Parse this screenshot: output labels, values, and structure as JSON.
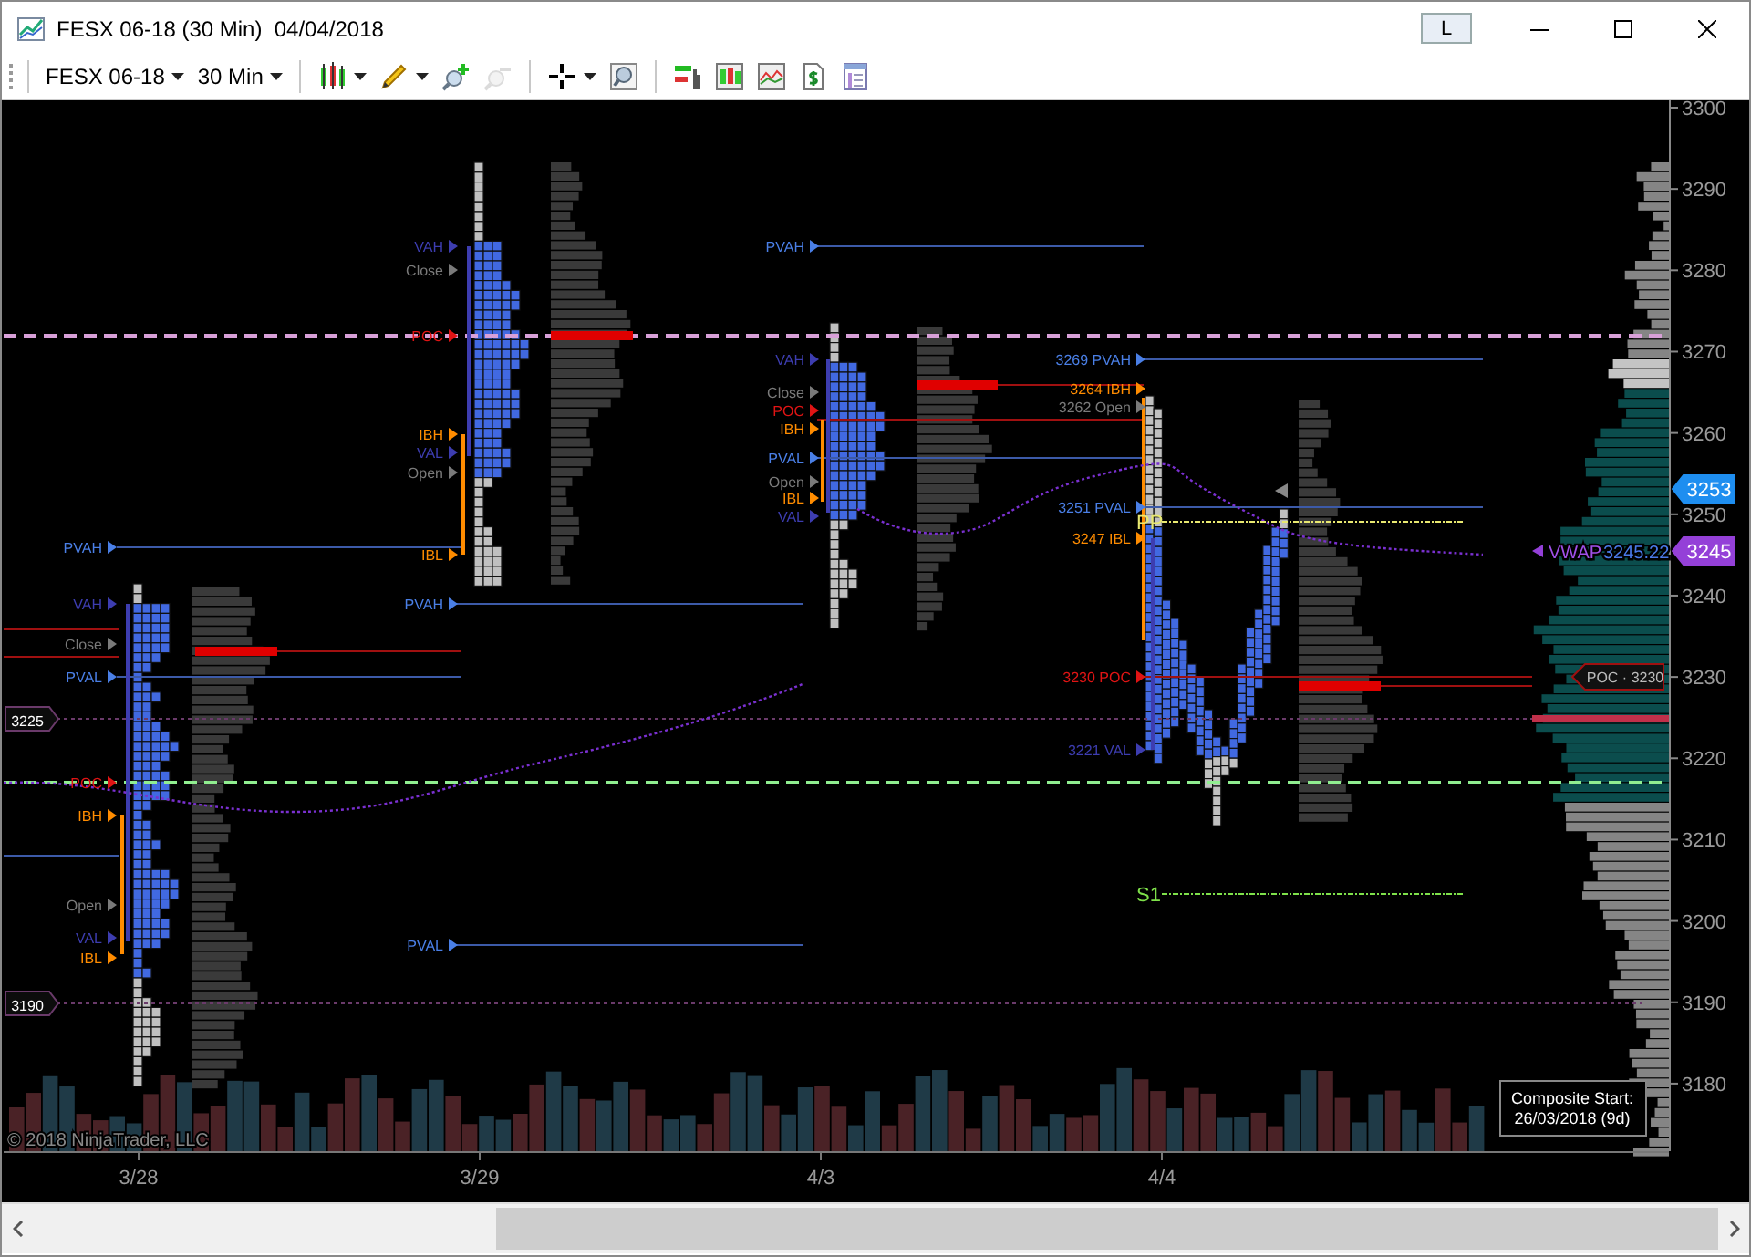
{
  "window": {
    "title": "FESX 06-18 (30 Min)  04/04/2018",
    "badge": "L"
  },
  "toolbar": {
    "instrument": "FESX 06-18",
    "interval": "30 Min",
    "tools": [
      {
        "kind": "chart-style",
        "disabled": false
      },
      {
        "kind": "drawing-tools",
        "disabled": false
      },
      {
        "kind": "zoom-in",
        "disabled": false
      },
      {
        "kind": "zoom-out",
        "disabled": true
      },
      {
        "kind": "crosshair",
        "disabled": false
      },
      {
        "kind": "zoom-box",
        "disabled": false
      },
      {
        "kind": "data-series",
        "disabled": false
      },
      {
        "kind": "bars",
        "disabled": false
      },
      {
        "kind": "indicators",
        "disabled": false
      },
      {
        "kind": "orders",
        "disabled": false
      },
      {
        "kind": "properties",
        "disabled": false
      }
    ]
  },
  "chart": {
    "level_labels": [
      {
        "text": "PVAH",
        "kind": "prior-value"
      },
      {
        "text": "VAH",
        "kind": "value-area"
      },
      {
        "text": "Close",
        "kind": "open-close"
      },
      {
        "text": "PVAL",
        "kind": "prior-value"
      },
      {
        "text": "POC",
        "kind": "poc"
      },
      {
        "text": "IBH",
        "kind": "initial-balance"
      },
      {
        "text": "Open",
        "kind": "open-close"
      },
      {
        "text": "VAL",
        "kind": "value-area"
      },
      {
        "text": "IBL",
        "kind": "initial-balance"
      },
      {
        "text": "VAH",
        "kind": "value-area"
      },
      {
        "text": "Close",
        "kind": "open-close"
      },
      {
        "text": "POC",
        "kind": "poc"
      },
      {
        "text": "IBH",
        "kind": "initial-balance"
      },
      {
        "text": "VAL",
        "kind": "value-area"
      },
      {
        "text": "Open",
        "kind": "open-close"
      },
      {
        "text": "IBL",
        "kind": "initial-balance"
      },
      {
        "text": "PVAH",
        "kind": "prior-value"
      },
      {
        "text": "PVAL",
        "kind": "prior-value"
      },
      {
        "text": "PVAH",
        "kind": "prior-value"
      },
      {
        "text": "VAH",
        "kind": "value-area"
      },
      {
        "text": "Close",
        "kind": "open-close"
      },
      {
        "text": "POC",
        "kind": "poc"
      },
      {
        "text": "IBH",
        "kind": "initial-balance"
      },
      {
        "text": "PVAL",
        "kind": "prior-value"
      },
      {
        "text": "Open",
        "kind": "open-close"
      },
      {
        "text": "IBL",
        "kind": "initial-balance"
      },
      {
        "text": "VAL",
        "kind": "value-area"
      },
      {
        "text": "3269 PVAH",
        "kind": "prior-value"
      },
      {
        "text": "3264 IBH",
        "kind": "initial-balance"
      },
      {
        "text": "3262 Open",
        "kind": "open-close"
      },
      {
        "text": "3251 PVAL",
        "kind": "prior-value"
      },
      {
        "text": "3247 IBL",
        "kind": "initial-balance"
      },
      {
        "text": "3230 POC",
        "kind": "poc"
      },
      {
        "text": "3221 VAL",
        "kind": "value-area"
      }
    ],
    "pivots": [
      {
        "text": "PP",
        "kind": "pivot"
      },
      {
        "text": "S1",
        "kind": "support"
      }
    ],
    "price_tags": [
      {
        "text": "3225",
        "kind": "session"
      },
      {
        "text": "3190",
        "kind": "session"
      },
      {
        "text": "3253",
        "kind": "last-price"
      },
      {
        "text": "3245",
        "kind": "vwap"
      }
    ],
    "vwap": {
      "label": "VWAP",
      "value": "3245.22"
    },
    "poc_tag": "POC · 3230",
    "price_axis": [
      "3300",
      "3290",
      "3280",
      "3270",
      "3260",
      "3250",
      "3240",
      "3230",
      "3220",
      "3210",
      "3200",
      "3190",
      "3180"
    ],
    "date_axis": [
      "3/28",
      "3/29",
      "4/3",
      "4/4"
    ],
    "copyright": "© 2018 NinjaTrader, LLC",
    "composite_note": [
      "Composite Start:",
      "26/03/2018 (9d)"
    ]
  }
}
